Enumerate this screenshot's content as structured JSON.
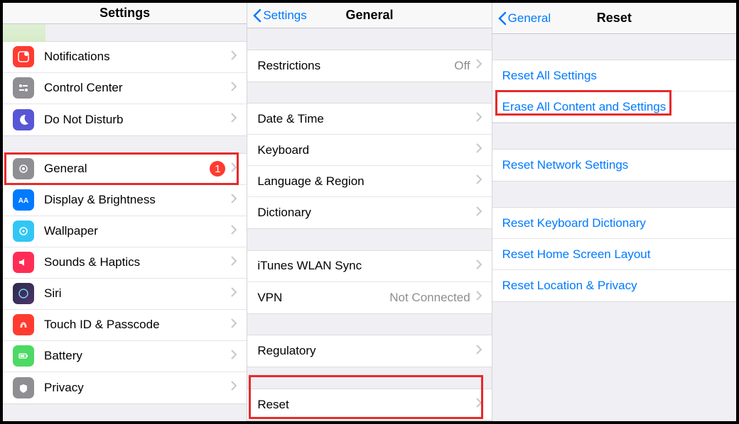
{
  "col1": {
    "title": "Settings",
    "group1": [
      {
        "label": "Notifications",
        "icon": "notifications",
        "bg": "#ff3b30"
      },
      {
        "label": "Control Center",
        "icon": "control",
        "bg": "#8e8e93"
      },
      {
        "label": "Do Not Disturb",
        "icon": "dnd",
        "bg": "#5856d6"
      }
    ],
    "group2": [
      {
        "label": "General",
        "icon": "general",
        "bg": "#8e8e93",
        "badge": "1"
      },
      {
        "label": "Display & Brightness",
        "icon": "display",
        "bg": "#007aff"
      },
      {
        "label": "Wallpaper",
        "icon": "wallpaper",
        "bg": "#33c6f4"
      },
      {
        "label": "Sounds & Haptics",
        "icon": "sounds",
        "bg": "#ff2d55"
      },
      {
        "label": "Siri",
        "icon": "siri",
        "bg": "#000"
      },
      {
        "label": "Touch ID & Passcode",
        "icon": "touchid",
        "bg": "#ff3b30"
      },
      {
        "label": "Battery",
        "icon": "battery",
        "bg": "#4cd964"
      },
      {
        "label": "Privacy",
        "icon": "privacy",
        "bg": "#8e8e93"
      }
    ]
  },
  "col2": {
    "back": "Settings",
    "title": "General",
    "group1": [
      {
        "label": "Restrictions",
        "value": "Off"
      }
    ],
    "group2": [
      {
        "label": "Date & Time"
      },
      {
        "label": "Keyboard"
      },
      {
        "label": "Language & Region"
      },
      {
        "label": "Dictionary"
      }
    ],
    "group3": [
      {
        "label": "iTunes WLAN Sync"
      },
      {
        "label": "VPN",
        "value": "Not Connected"
      }
    ],
    "group4": [
      {
        "label": "Regulatory"
      }
    ],
    "group5": [
      {
        "label": "Reset"
      }
    ]
  },
  "col3": {
    "back": "General",
    "title": "Reset",
    "group1": [
      {
        "label": "Reset All Settings"
      },
      {
        "label": "Erase All Content and Settings"
      }
    ],
    "group2": [
      {
        "label": "Reset Network Settings"
      }
    ],
    "group3": [
      {
        "label": "Reset Keyboard Dictionary"
      },
      {
        "label": "Reset Home Screen Layout"
      },
      {
        "label": "Reset Location & Privacy"
      }
    ]
  }
}
